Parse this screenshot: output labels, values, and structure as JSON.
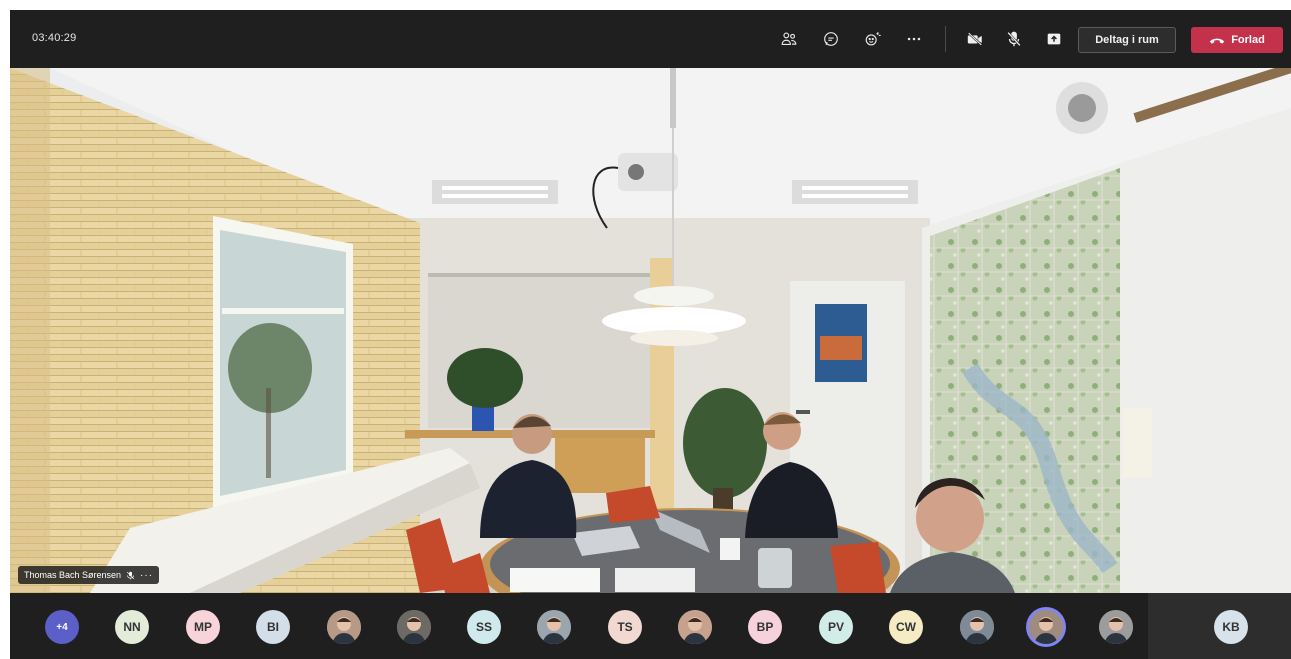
{
  "meeting": {
    "timer": "03:40:29",
    "join_room_label": "Deltag i rum",
    "leave_label": "Forlad",
    "colors": {
      "leave": "#c4314b",
      "bar": "#1f1f1f",
      "accent": "#7f85f5"
    }
  },
  "toolbar": {
    "icons": [
      "people-icon",
      "chat-icon",
      "reactions-icon",
      "more-icon",
      "camera-off-icon",
      "mic-off-icon",
      "share-icon"
    ]
  },
  "speaker": {
    "name": "Thomas Bach Sørensen"
  },
  "participants": [
    {
      "initials": "+4",
      "kind": "more"
    },
    {
      "initials": "NN",
      "color": "#e3ecd9"
    },
    {
      "initials": "MP",
      "color": "#f6d4da"
    },
    {
      "initials": "BI",
      "color": "#d3dee8"
    },
    {
      "initials": "",
      "kind": "photo"
    },
    {
      "initials": "",
      "kind": "photo"
    },
    {
      "initials": "SS",
      "color": "#cfe9ec"
    },
    {
      "initials": "",
      "kind": "photo"
    },
    {
      "initials": "TS",
      "color": "#f1d9d2"
    },
    {
      "initials": "",
      "kind": "photo"
    },
    {
      "initials": "BP",
      "color": "#f6d3dc"
    },
    {
      "initials": "PV",
      "color": "#d2ece8"
    },
    {
      "initials": "CW",
      "color": "#f5ecc4"
    },
    {
      "initials": "",
      "kind": "photo"
    },
    {
      "initials": "",
      "kind": "photo",
      "active": true
    },
    {
      "initials": "",
      "kind": "photo"
    },
    {
      "initials": "KB",
      "color": "#d7e2ea"
    }
  ]
}
